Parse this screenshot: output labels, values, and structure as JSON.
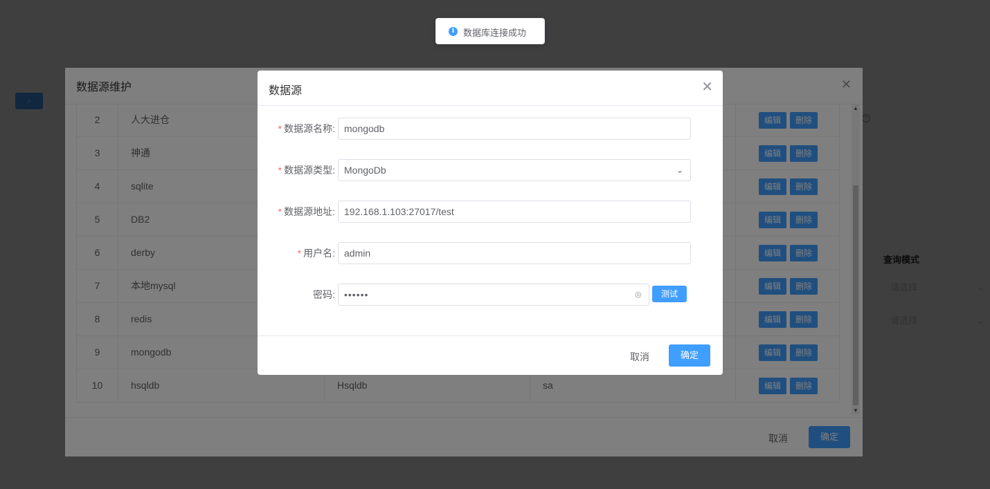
{
  "toast": {
    "text": "数据库连接成功",
    "icon": "info-icon"
  },
  "background": {
    "right_label": "查询模式",
    "select_placeholder_1": "请选择",
    "select_placeholder_2": "请选择"
  },
  "main_dialog": {
    "title": "数据源维护",
    "rows": [
      {
        "index": "2",
        "name": "人大进仓",
        "type": "",
        "user": ""
      },
      {
        "index": "3",
        "name": "神通",
        "type": "",
        "user": ""
      },
      {
        "index": "4",
        "name": "sqlite",
        "type": "",
        "user": ""
      },
      {
        "index": "5",
        "name": "DB2",
        "type": "",
        "user": ""
      },
      {
        "index": "6",
        "name": "derby",
        "type": "",
        "user": ""
      },
      {
        "index": "7",
        "name": "本地mysql",
        "type": "",
        "user": ""
      },
      {
        "index": "8",
        "name": "redis",
        "type": "",
        "user": ""
      },
      {
        "index": "9",
        "name": "mongodb",
        "type": "",
        "user": ""
      },
      {
        "index": "10",
        "name": "hsqldb",
        "type": "Hsqldb",
        "user": "sa"
      }
    ],
    "edit_label": "编辑",
    "delete_label": "删除",
    "cancel_label": "取消",
    "ok_label": "确定"
  },
  "ds_dialog": {
    "title": "数据源",
    "fields": {
      "name_label": "数据源名称:",
      "name_value": "mongodb",
      "type_label": "数据源类型:",
      "type_value": "MongoDb",
      "addr_label": "数据源地址:",
      "addr_value": "192.168.1.103:27017/test",
      "user_label": "用户名:",
      "user_value": "admin",
      "pwd_label": "密码:",
      "pwd_value": "••••••"
    },
    "required_mark": "*",
    "test_label": "测试",
    "cancel_label": "取消",
    "ok_label": "确定"
  }
}
